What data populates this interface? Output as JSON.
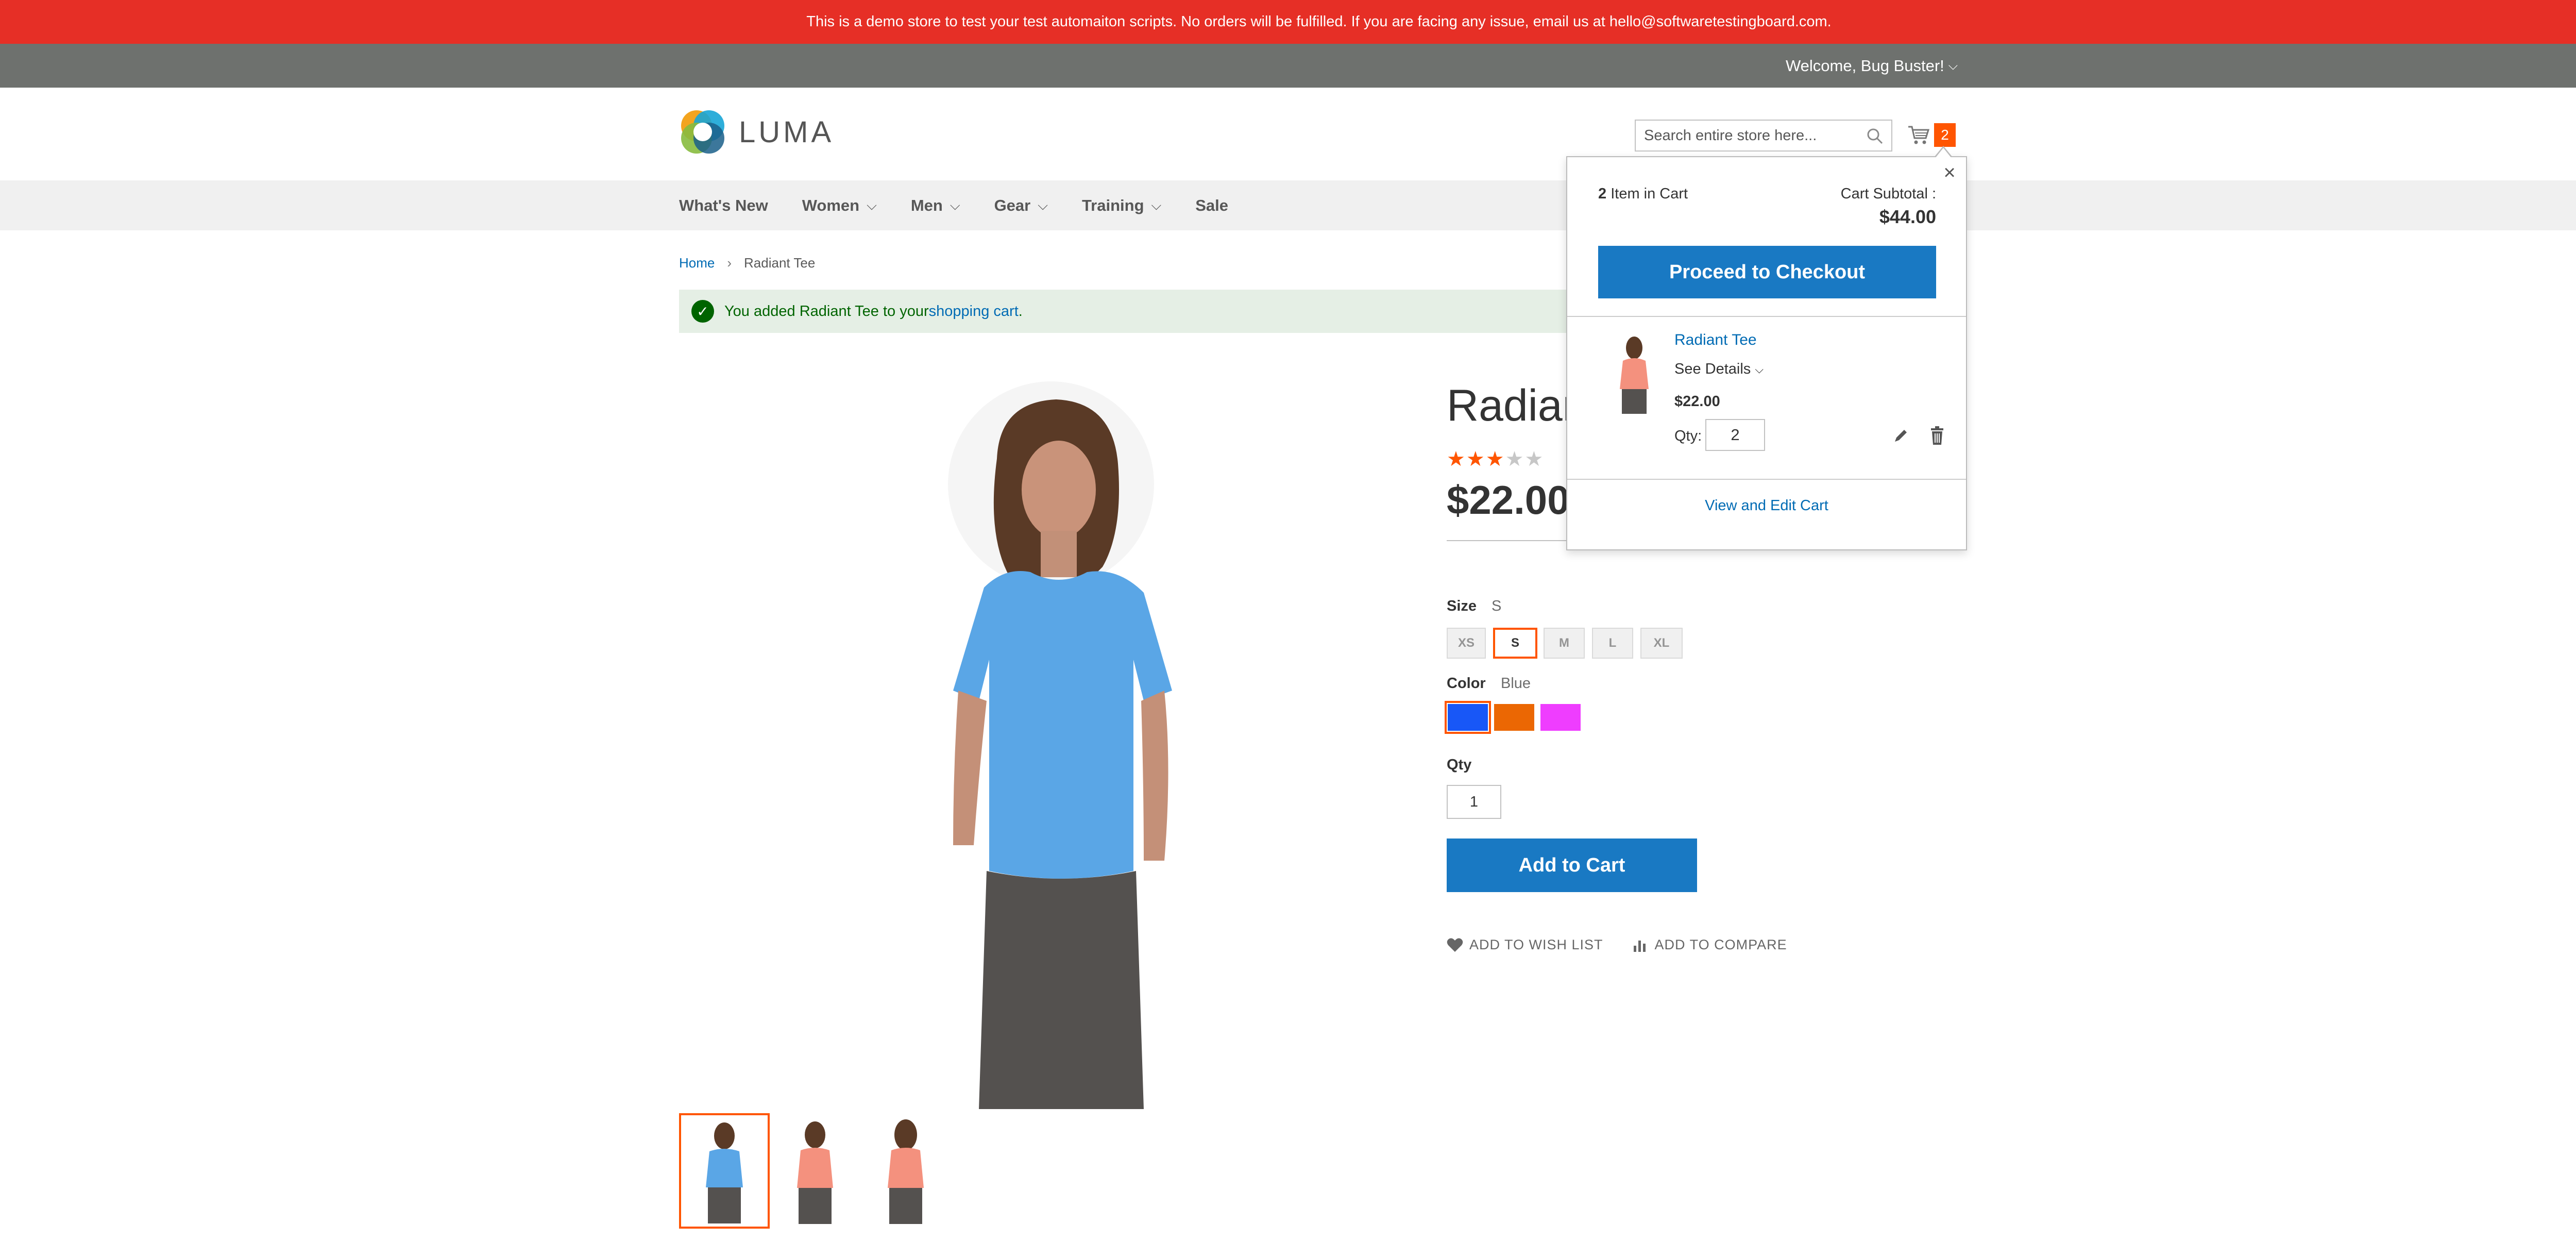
{
  "banner": {
    "text": "This is a demo store to test your test automaiton scripts. No orders will be fulfilled. If you are facing any issue, email us at hello@softwaretestingboard.com.",
    "color": "#e62f26"
  },
  "panel": {
    "welcome": "Welcome, Bug Buster!"
  },
  "header": {
    "logo_text": "LUMA",
    "search": {
      "placeholder": "Search entire store here...",
      "value": ""
    },
    "cart_count": "2"
  },
  "nav": {
    "items": [
      {
        "label": "What's New",
        "has_dropdown": false
      },
      {
        "label": "Women",
        "has_dropdown": true
      },
      {
        "label": "Men",
        "has_dropdown": true
      },
      {
        "label": "Gear",
        "has_dropdown": true
      },
      {
        "label": "Training",
        "has_dropdown": true
      },
      {
        "label": "Sale",
        "has_dropdown": false
      }
    ]
  },
  "breadcrumbs": {
    "home": "Home",
    "separator": "›",
    "current": "Radiant Tee"
  },
  "message": {
    "prefix": "You added Radiant Tee to your ",
    "link": "shopping cart",
    "suffix": "."
  },
  "product": {
    "title": "Radiant Tee",
    "rating_stars": 3,
    "rating_max": 5,
    "price": "$22.00",
    "size": {
      "label": "Size",
      "selected": "S",
      "options": [
        "XS",
        "S",
        "M",
        "L",
        "XL"
      ]
    },
    "color": {
      "label": "Color",
      "selected": "Blue",
      "options": [
        {
          "name": "Blue",
          "hex": "#1857f7"
        },
        {
          "name": "Orange",
          "hex": "#eb6703"
        },
        {
          "name": "Purple",
          "hex": "#ef3dff"
        }
      ]
    },
    "qty": {
      "label": "Qty",
      "value": "1"
    },
    "add_to_cart": "Add to Cart",
    "wishlist": "ADD TO WISH LIST",
    "compare": "ADD TO COMPARE"
  },
  "minicart": {
    "count": "2",
    "count_label": "Item in Cart",
    "subtotal_label": "Cart Subtotal :",
    "subtotal": "$44.00",
    "checkout": "Proceed to Checkout",
    "item": {
      "name": "Radiant Tee",
      "see_details": "See Details",
      "price": "$22.00",
      "qty_label": "Qty:",
      "qty": "2"
    },
    "view_cart": "View and Edit Cart"
  },
  "colors": {
    "accent_orange": "#ff5501",
    "button_blue": "#1979c3",
    "link_blue": "#006bb4",
    "success_green": "#006400"
  }
}
